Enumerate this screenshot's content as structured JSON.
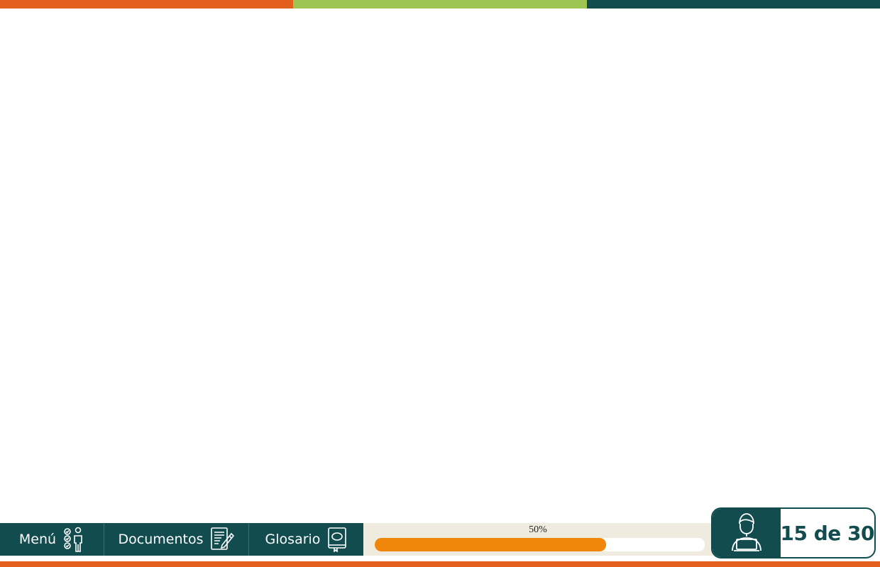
{
  "colors": {
    "orange": "#e35f1c",
    "green": "#9dc552",
    "teal": "#124c4f",
    "progress_fill": "#f0870a",
    "progress_bg": "#f0ebdf"
  },
  "nav": {
    "menu_label": "Menú",
    "menu_icon": "checklist-person-icon",
    "documents_label": "Documentos",
    "documents_icon": "document-edit-icon",
    "glossary_label": "Glosario",
    "glossary_icon": "book-icon"
  },
  "progress": {
    "label": "50%",
    "fill_fraction": 0.7
  },
  "pager": {
    "avatar_icon": "student-laptop-icon",
    "counter": "15 de 30"
  }
}
